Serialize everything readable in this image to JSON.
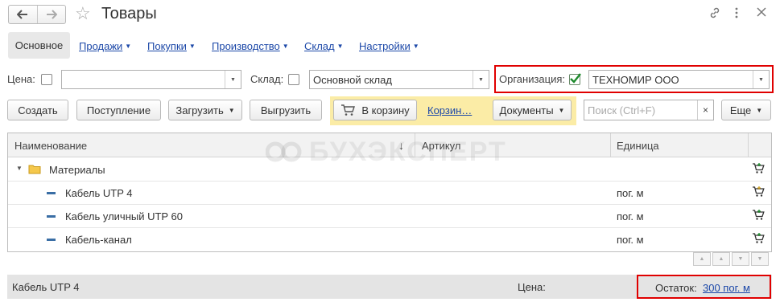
{
  "window": {
    "title": "Товары",
    "back_icon": "arrow-left-icon",
    "forward_icon": "arrow-right-icon",
    "favorite_icon": "star-icon",
    "link_icon": "link-icon",
    "more_icon": "more-vertical-icon",
    "close_icon": "close-icon"
  },
  "tabs": {
    "main": "Основное",
    "items": [
      {
        "label": "Продажи"
      },
      {
        "label": "Покупки"
      },
      {
        "label": "Производство"
      },
      {
        "label": "Склад"
      },
      {
        "label": "Настройки"
      }
    ]
  },
  "filters": {
    "price_label": "Цена:",
    "price_value": "",
    "warehouse_label": "Склад:",
    "warehouse_value": "Основной склад",
    "org_label": "Организация:",
    "org_checked": true,
    "org_value": "ТЕХНОМИР ООО",
    "highlight_color": "#e00000"
  },
  "toolbar": {
    "create": "Создать",
    "receipt": "Поступление",
    "load": "Загрузить",
    "unload": "Выгрузить",
    "to_cart": "В корзину",
    "cart_link": "Корзин…",
    "documents": "Документы",
    "search_placeholder": "Поиск (Ctrl+F)",
    "more": "Еще",
    "cart_panel_color": "#fbeca6"
  },
  "table": {
    "columns": [
      "Наименование",
      "Артикул",
      "Единица"
    ],
    "sort_indicator": "↓",
    "rows": [
      {
        "type": "group",
        "name": "Материалы",
        "article": "",
        "unit": ""
      },
      {
        "type": "item",
        "name": "Кабель UTP 4",
        "article": "",
        "unit": "пог. м"
      },
      {
        "type": "item",
        "name": "Кабель уличный UTP 60",
        "article": "",
        "unit": "пог. м"
      },
      {
        "type": "item",
        "name": "Кабель-канал",
        "article": "",
        "unit": "пог. м"
      }
    ]
  },
  "watermark": "БУХЭКСПЕРТ",
  "status": {
    "selected_name": "Кабель UTP 4",
    "price_label": "Цена:",
    "stock_label": "Остаток:",
    "stock_value": "300 пог. м"
  }
}
